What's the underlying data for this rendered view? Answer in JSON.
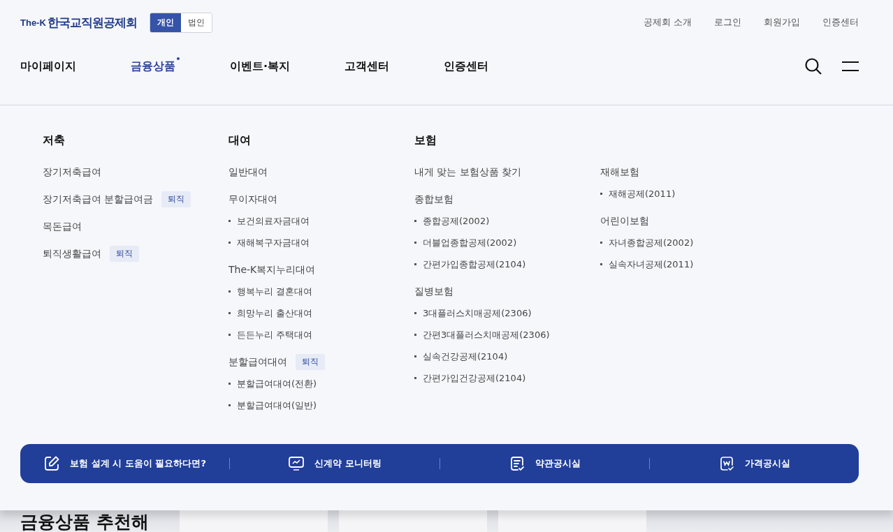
{
  "logo": {
    "prefix": "The-K",
    "name": "한국교직원공제회"
  },
  "member_toggle": [
    {
      "label": "개인",
      "selected": true
    },
    {
      "label": "법인",
      "selected": false
    }
  ],
  "util_links": [
    "공제회 소개",
    "로그인",
    "회원가입",
    "인증센터"
  ],
  "nav": [
    {
      "label": "마이페이지",
      "selected": false
    },
    {
      "label": "금융상품",
      "selected": true
    },
    {
      "label": "이벤트·복지",
      "selected": false
    },
    {
      "label": "고객센터",
      "selected": false
    },
    {
      "label": "인증센터",
      "selected": false
    }
  ],
  "mega_menu": [
    {
      "heading": "저축",
      "items": [
        {
          "label": "장기저축급여"
        },
        {
          "label": "장기저축급여 분할급여금",
          "badge": "퇴직"
        },
        {
          "label": "목돈급여"
        },
        {
          "label": "퇴직생활급여",
          "badge": "퇴직"
        }
      ]
    },
    {
      "heading": "대여",
      "items": [
        {
          "label": "일반대여"
        },
        {
          "label": "무이자대여",
          "children": [
            "보건의료자금대여",
            "재해복구자금대여"
          ]
        },
        {
          "label": "The-K복지누리대여",
          "children": [
            "행복누리 결혼대여",
            "희망누리 출산대여",
            "든든누리 주택대여"
          ]
        },
        {
          "label": "분할급여대여",
          "badge": "퇴직",
          "children": [
            "분할급여대여(전환)",
            "분할급여대여(일반)"
          ]
        }
      ]
    },
    {
      "heading": "보험",
      "items": [
        {
          "label": "내게 맞는 보험상품 찾기"
        },
        {
          "label": "종합보험",
          "children": [
            "종합공제(2002)",
            "더블업종합공제(2002)",
            "간편가입종합공제(2104)"
          ]
        },
        {
          "label": "질병보험",
          "children": [
            "3대플러스치매공제(2306)",
            "간편3대플러스치매공제(2306)",
            "실속건강공제(2104)",
            "간편가입건강공제(2104)"
          ]
        }
      ]
    },
    {
      "items": [
        {
          "label": "재해보험",
          "children": [
            "재해공제(2011)"
          ]
        },
        {
          "label": "어린이보험",
          "children": [
            "자녀종합공제(2002)",
            "실속자녀공제(2011)"
          ]
        }
      ]
    }
  ],
  "quick_links": [
    {
      "label": "보험 설계 시 도움이 필요하다면?",
      "kind": "pen"
    },
    {
      "label": "신계약 모니터링",
      "kind": "monitor"
    },
    {
      "label": "약관공시실",
      "kind": "doc"
    },
    {
      "label": "가격공시실",
      "kind": "price"
    }
  ],
  "below": {
    "heading": "금융상품 추천해"
  }
}
